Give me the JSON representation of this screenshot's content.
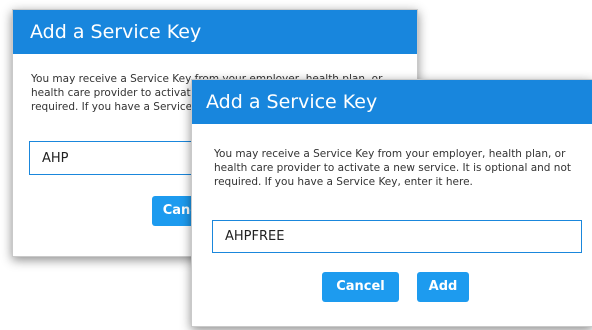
{
  "back_dialog": {
    "title": "Add a Service Key",
    "message": "You may receive a Service Key from your employer, health plan, or health care provider to activate a new service. It is optional and not required. If you have a Service Key, enter it here.",
    "input_value": "AHP",
    "cancel_label": "Cancel"
  },
  "front_dialog": {
    "title": "Add a Service Key",
    "message": "You may receive a Service Key from your employer, health plan, or health care provider to activate a new service. It is optional and not required. If you have a Service Key, enter it here.",
    "input_value": "AHPFREE",
    "cancel_label": "Cancel",
    "add_label": "Add"
  },
  "colors": {
    "titlebar": "#1886dd",
    "button": "#1d9bef",
    "input_border": "#1a87dc"
  }
}
